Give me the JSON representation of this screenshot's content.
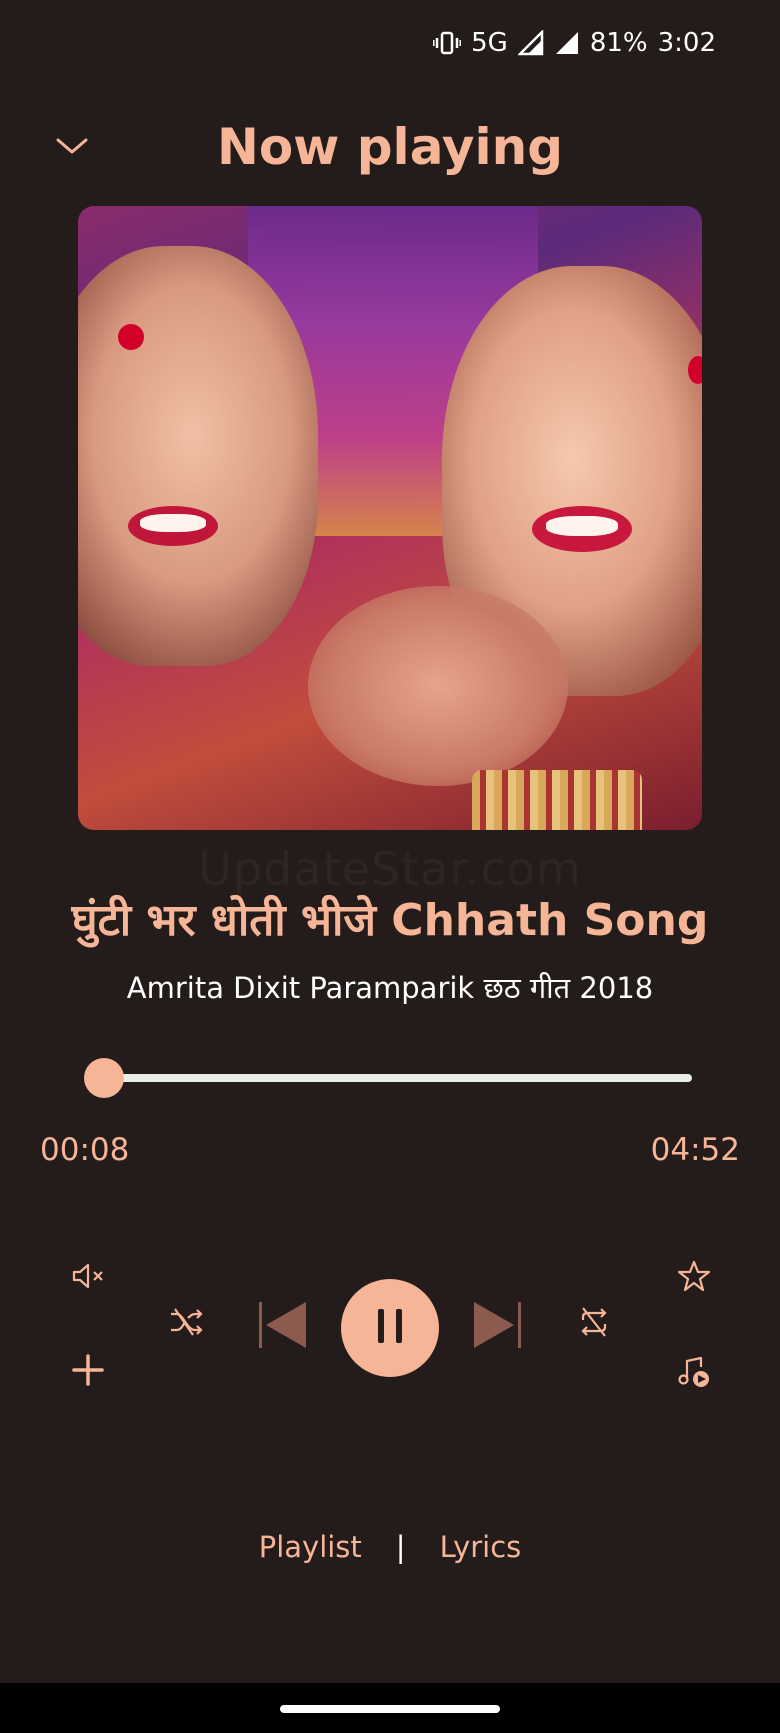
{
  "status_bar": {
    "network": "5G",
    "battery": "81%",
    "time": "3:02",
    "icons": [
      "vibrate-icon",
      "signal-icon",
      "signal-icon"
    ]
  },
  "header": {
    "title": "Now playing",
    "collapse_icon": "chevron-down-icon"
  },
  "album_art": {
    "watermark": "UpdateStar.com"
  },
  "track": {
    "title": "घुंटी भर धोती भीजे Chhath Song",
    "artist": "Amrita Dixit Paramparik छठ गीत 2018"
  },
  "progress": {
    "elapsed": "00:08",
    "total": "04:52",
    "fraction": 0.027
  },
  "controls": {
    "mute_icon": "volume-mute-icon",
    "favorite_icon": "star-icon",
    "add_icon": "plus-icon",
    "queue_icon": "music-queue-icon",
    "shuffle_icon": "shuffle-off-icon",
    "previous_icon": "skip-previous-icon",
    "play_pause_icon": "pause-icon",
    "next_icon": "skip-next-icon",
    "repeat_icon": "repeat-off-icon"
  },
  "bottom_tabs": {
    "playlist": "Playlist",
    "separator": "|",
    "lyrics": "Lyrics"
  },
  "colors": {
    "background": "#231c1b",
    "accent": "#f5b596",
    "track": "#e9efe6"
  }
}
